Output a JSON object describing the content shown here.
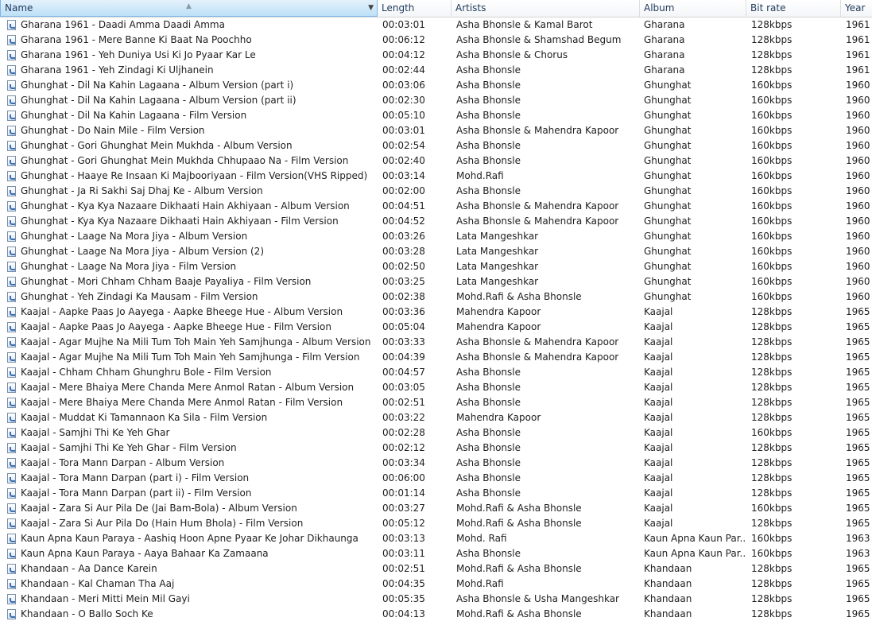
{
  "columns": {
    "name": "Name",
    "length": "Length",
    "artists": "Artists",
    "album": "Album",
    "bitrate": "Bit rate",
    "year": "Year"
  },
  "rows": [
    {
      "name": "Gharana 1961 - Daadi Amma Daadi Amma",
      "length": "00:03:01",
      "artists": "Asha Bhonsle & Kamal Barot",
      "album": "Gharana",
      "bitrate": "128kbps",
      "year": "1961"
    },
    {
      "name": "Gharana 1961 - Mere Banne Ki Baat Na Poochho",
      "length": "00:06:12",
      "artists": "Asha Bhonsle & Shamshad Begum",
      "album": "Gharana",
      "bitrate": "128kbps",
      "year": "1961"
    },
    {
      "name": "Gharana 1961 - Yeh Duniya Usi Ki Jo Pyaar Kar Le",
      "length": "00:04:12",
      "artists": "Asha Bhonsle & Chorus",
      "album": "Gharana",
      "bitrate": "128kbps",
      "year": "1961"
    },
    {
      "name": "Gharana 1961 - Yeh Zindagi Ki Uljhanein",
      "length": "00:02:44",
      "artists": "Asha Bhonsle",
      "album": "Gharana",
      "bitrate": "128kbps",
      "year": "1961"
    },
    {
      "name": "Ghunghat - Dil Na Kahin Lagaana - Album Version (part i)",
      "length": "00:03:06",
      "artists": "Asha Bhonsle",
      "album": "Ghunghat",
      "bitrate": "160kbps",
      "year": "1960"
    },
    {
      "name": "Ghunghat - Dil Na Kahin Lagaana - Album Version (part ii)",
      "length": "00:02:30",
      "artists": "Asha Bhonsle",
      "album": "Ghunghat",
      "bitrate": "160kbps",
      "year": "1960"
    },
    {
      "name": "Ghunghat - Dil Na Kahin Lagaana - Film Version",
      "length": "00:05:10",
      "artists": "Asha Bhonsle",
      "album": "Ghunghat",
      "bitrate": "160kbps",
      "year": "1960"
    },
    {
      "name": "Ghunghat - Do Nain Mile - Film Version",
      "length": "00:03:01",
      "artists": "Asha Bhonsle & Mahendra Kapoor",
      "album": "Ghunghat",
      "bitrate": "160kbps",
      "year": "1960"
    },
    {
      "name": "Ghunghat - Gori Ghunghat Mein Mukhda - Album Version",
      "length": "00:02:54",
      "artists": "Asha Bhonsle",
      "album": "Ghunghat",
      "bitrate": "160kbps",
      "year": "1960"
    },
    {
      "name": "Ghunghat - Gori Ghunghat Mein Mukhda Chhupaao Na - Film Version",
      "length": "00:02:40",
      "artists": "Asha Bhonsle",
      "album": "Ghunghat",
      "bitrate": "160kbps",
      "year": "1960"
    },
    {
      "name": "Ghunghat - Haaye Re Insaan Ki Majbooriyaan - Film Version(VHS Ripped)",
      "length": "00:03:14",
      "artists": "Mohd.Rafi",
      "album": "Ghunghat",
      "bitrate": "160kbps",
      "year": "1960"
    },
    {
      "name": "Ghunghat - Ja Ri Sakhi Saj Dhaj Ke - Album Version",
      "length": "00:02:00",
      "artists": "Asha Bhonsle",
      "album": "Ghunghat",
      "bitrate": "160kbps",
      "year": "1960"
    },
    {
      "name": "Ghunghat - Kya Kya Nazaare Dikhaati Hain Akhiyaan - Album Version",
      "length": "00:04:51",
      "artists": "Asha Bhonsle & Mahendra Kapoor",
      "album": "Ghunghat",
      "bitrate": "160kbps",
      "year": "1960"
    },
    {
      "name": "Ghunghat - Kya Kya Nazaare Dikhaati Hain Akhiyaan - Film Version",
      "length": "00:04:52",
      "artists": "Asha Bhonsle & Mahendra Kapoor",
      "album": "Ghunghat",
      "bitrate": "160kbps",
      "year": "1960"
    },
    {
      "name": "Ghunghat - Laage Na Mora Jiya - Album Version",
      "length": "00:03:26",
      "artists": "Lata Mangeshkar",
      "album": "Ghunghat",
      "bitrate": "160kbps",
      "year": "1960"
    },
    {
      "name": "Ghunghat - Laage Na Mora Jiya - Album Version (2)",
      "length": "00:03:28",
      "artists": "Lata Mangeshkar",
      "album": "Ghunghat",
      "bitrate": "160kbps",
      "year": "1960"
    },
    {
      "name": "Ghunghat - Laage Na Mora Jiya - Film Version",
      "length": "00:02:50",
      "artists": "Lata Mangeshkar",
      "album": "Ghunghat",
      "bitrate": "160kbps",
      "year": "1960"
    },
    {
      "name": "Ghunghat - Mori Chham Chham Baaje Payaliya - Film Version",
      "length": "00:03:25",
      "artists": "Lata Mangeshkar",
      "album": "Ghunghat",
      "bitrate": "160kbps",
      "year": "1960"
    },
    {
      "name": "Ghunghat - Yeh Zindagi Ka Mausam - Film Version",
      "length": "00:02:38",
      "artists": "Mohd.Rafi & Asha Bhonsle",
      "album": "Ghunghat",
      "bitrate": "160kbps",
      "year": "1960"
    },
    {
      "name": "Kaajal - Aapke Paas Jo Aayega - Aapke Bheege Hue - Album Version",
      "length": "00:03:36",
      "artists": "Mahendra Kapoor",
      "album": "Kaajal",
      "bitrate": "128kbps",
      "year": "1965"
    },
    {
      "name": "Kaajal - Aapke Paas Jo Aayega - Aapke Bheege Hue - Film Version",
      "length": "00:05:04",
      "artists": "Mahendra Kapoor",
      "album": "Kaajal",
      "bitrate": "128kbps",
      "year": "1965"
    },
    {
      "name": "Kaajal - Agar Mujhe Na Mili Tum Toh Main Yeh Samjhunga - Album Version",
      "length": "00:03:33",
      "artists": "Asha Bhonsle & Mahendra Kapoor",
      "album": "Kaajal",
      "bitrate": "128kbps",
      "year": "1965"
    },
    {
      "name": "Kaajal - Agar Mujhe Na Mili Tum Toh Main Yeh Samjhunga - Film Version",
      "length": "00:04:39",
      "artists": "Asha Bhonsle & Mahendra Kapoor",
      "album": "Kaajal",
      "bitrate": "128kbps",
      "year": "1965"
    },
    {
      "name": "Kaajal - Chham Chham Ghunghru Bole - Film Version",
      "length": "00:04:57",
      "artists": "Asha Bhonsle",
      "album": "Kaajal",
      "bitrate": "128kbps",
      "year": "1965"
    },
    {
      "name": "Kaajal - Mere Bhaiya Mere Chanda Mere Anmol Ratan - Album Version",
      "length": "00:03:05",
      "artists": "Asha Bhonsle",
      "album": "Kaajal",
      "bitrate": "128kbps",
      "year": "1965"
    },
    {
      "name": "Kaajal - Mere Bhaiya Mere Chanda Mere Anmol Ratan - Film Version",
      "length": "00:02:51",
      "artists": "Asha Bhonsle",
      "album": "Kaajal",
      "bitrate": "128kbps",
      "year": "1965"
    },
    {
      "name": "Kaajal - Muddat Ki Tamannaon Ka Sila - Film Version",
      "length": "00:03:22",
      "artists": "Mahendra Kapoor",
      "album": "Kaajal",
      "bitrate": "128kbps",
      "year": "1965"
    },
    {
      "name": "Kaajal - Samjhi Thi Ke Yeh Ghar",
      "length": "00:02:28",
      "artists": "Asha Bhonsle",
      "album": "Kaajal",
      "bitrate": "160kbps",
      "year": "1965"
    },
    {
      "name": "Kaajal - Samjhi Thi Ke Yeh Ghar - Film Version",
      "length": "00:02:12",
      "artists": "Asha Bhonsle",
      "album": "Kaajal",
      "bitrate": "128kbps",
      "year": "1965"
    },
    {
      "name": "Kaajal - Tora Mann Darpan - Album Version",
      "length": "00:03:34",
      "artists": "Asha Bhonsle",
      "album": "Kaajal",
      "bitrate": "128kbps",
      "year": "1965"
    },
    {
      "name": "Kaajal - Tora Mann Darpan (part i) - Film Version",
      "length": "00:06:00",
      "artists": "Asha Bhonsle",
      "album": "Kaajal",
      "bitrate": "128kbps",
      "year": "1965"
    },
    {
      "name": "Kaajal - Tora Mann Darpan (part ii) - Film Version",
      "length": "00:01:14",
      "artists": "Asha Bhonsle",
      "album": "Kaajal",
      "bitrate": "128kbps",
      "year": "1965"
    },
    {
      "name": "Kaajal - Zara Si Aur Pila De (Jai Bam-Bola) -  Album Version",
      "length": "00:03:27",
      "artists": "Mohd.Rafi & Asha Bhonsle",
      "album": "Kaajal",
      "bitrate": "160kbps",
      "year": "1965"
    },
    {
      "name": "Kaajal - Zara Si Aur Pila Do (Hain Hum Bhola) - Film Version",
      "length": "00:05:12",
      "artists": "Mohd.Rafi & Asha Bhonsle",
      "album": "Kaajal",
      "bitrate": "128kbps",
      "year": "1965"
    },
    {
      "name": "Kaun Apna Kaun Paraya - Aashiq Hoon Apne Pyaar Ke Johar Dikhaunga",
      "length": "00:03:13",
      "artists": "Mohd. Rafi",
      "album": "Kaun Apna Kaun Par...",
      "bitrate": "160kbps",
      "year": "1963"
    },
    {
      "name": "Kaun Apna Kaun Paraya - Aaya Bahaar Ka Zamaana",
      "length": "00:03:11",
      "artists": "Asha Bhonsle",
      "album": "Kaun Apna Kaun Par...",
      "bitrate": "160kbps",
      "year": "1963"
    },
    {
      "name": "Khandaan - Aa Dance Karein",
      "length": "00:02:51",
      "artists": "Mohd.Rafi & Asha Bhonsle",
      "album": "Khandaan",
      "bitrate": "128kbps",
      "year": "1965"
    },
    {
      "name": "Khandaan - Kal Chaman Tha Aaj",
      "length": "00:04:35",
      "artists": "Mohd.Rafi",
      "album": "Khandaan",
      "bitrate": "128kbps",
      "year": "1965"
    },
    {
      "name": "Khandaan - Meri Mitti Mein Mil Gayi",
      "length": "00:05:35",
      "artists": "Asha Bhonsle & Usha Mangeshkar",
      "album": "Khandaan",
      "bitrate": "128kbps",
      "year": "1965"
    },
    {
      "name": "Khandaan - O Ballo Soch Ke",
      "length": "00:04:13",
      "artists": "Mohd.Rafi & Asha Bhonsle",
      "album": "Khandaan",
      "bitrate": "128kbps",
      "year": "1965"
    }
  ]
}
